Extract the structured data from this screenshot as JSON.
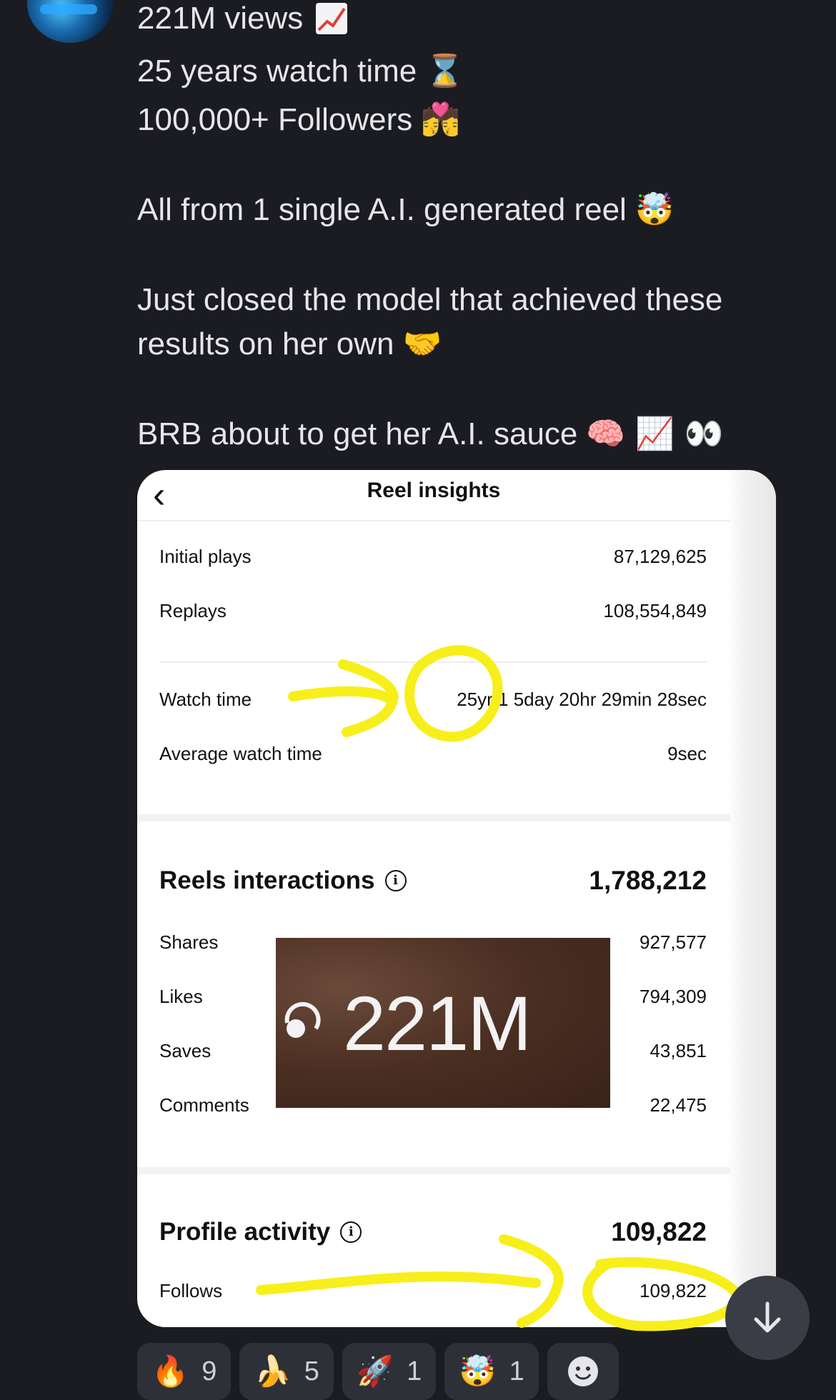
{
  "message": {
    "lines": [
      {
        "text": "221M views",
        "emoji": "chart-increasing"
      },
      {
        "text": "25 years watch time",
        "emoji": "⌛"
      },
      {
        "text": "100,000+ Followers",
        "emoji": "💏"
      },
      {
        "text": ""
      },
      {
        "text": "All from 1 single A.I. generated reel",
        "emoji": "🤯"
      },
      {
        "text": ""
      },
      {
        "text": "Just closed the model that achieved these"
      },
      {
        "text": "results on her own",
        "emoji": "🤝"
      },
      {
        "text": ""
      },
      {
        "text": "BRB about to get her A.I. sauce",
        "emoji": "🧠 📈 👀"
      }
    ]
  },
  "insights": {
    "title": "Reel insights",
    "rows1": [
      {
        "label": "Initial plays",
        "value": "87,129,625"
      },
      {
        "label": "Replays",
        "value": "108,554,849"
      }
    ],
    "rows2": [
      {
        "label": "Watch time",
        "value": "25yr 1 5day 20hr 29min 28sec"
      },
      {
        "label": "Average watch time",
        "value": "9sec"
      }
    ],
    "interactions": {
      "title": "Reels interactions",
      "total": "1,788,212",
      "rows": [
        {
          "label": "Shares",
          "value": "927,577"
        },
        {
          "label": "Likes",
          "value": "794,309"
        },
        {
          "label": "Saves",
          "value": "43,851"
        },
        {
          "label": "Comments",
          "value": "22,475"
        }
      ]
    },
    "overlay_views": "221M",
    "profile": {
      "title": "Profile activity",
      "total": "109,822",
      "rows": [
        {
          "label": "Follows",
          "value": "109,822"
        }
      ]
    }
  },
  "reactions": [
    {
      "emoji": "🔥",
      "count": "9"
    },
    {
      "emoji": "🍌",
      "count": "5"
    },
    {
      "emoji": "🚀",
      "count": "1"
    },
    {
      "emoji": "🤯",
      "count": "1"
    }
  ],
  "colors": {
    "background": "#1b1c22",
    "highlight": "#f7ef1a",
    "card": "#ffffff"
  }
}
